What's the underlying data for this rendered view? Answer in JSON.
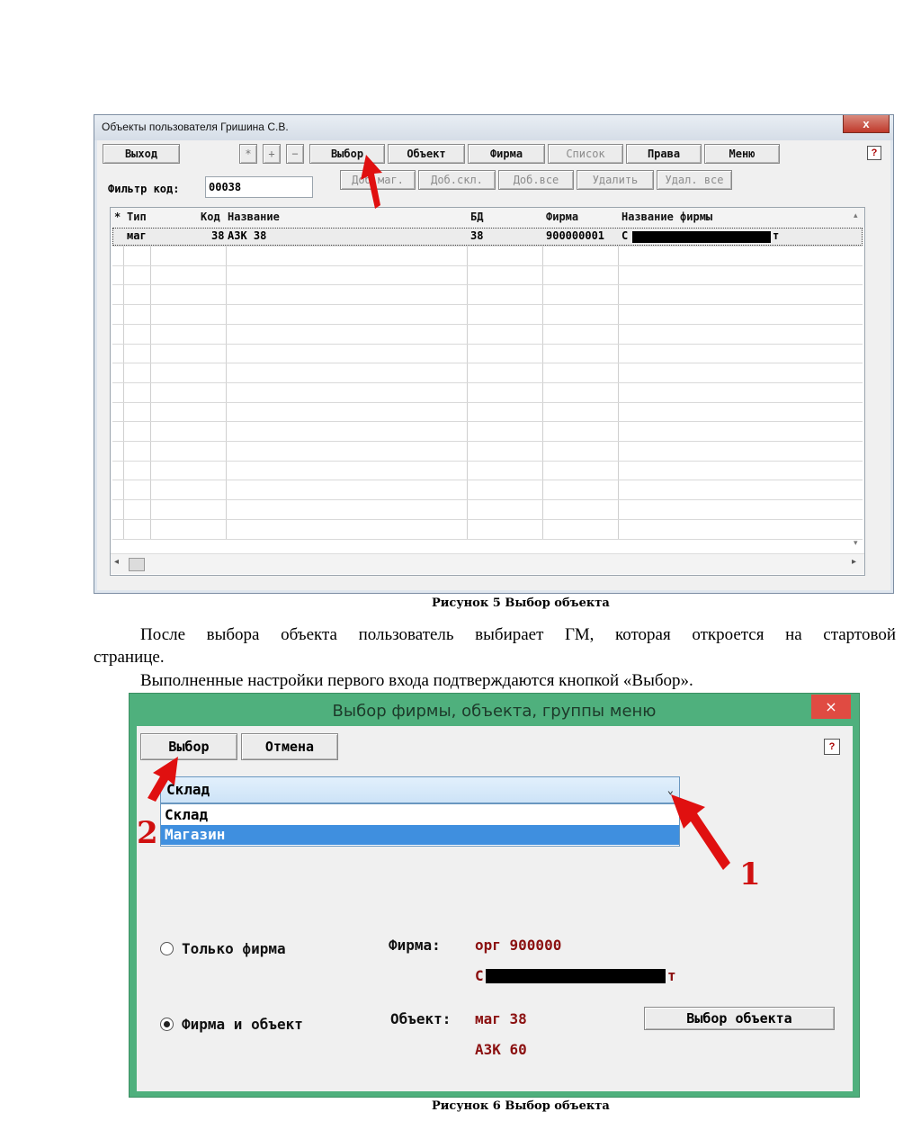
{
  "window1": {
    "title": "Объекты пользователя Гришина С.В.",
    "close_glyph": "x",
    "help_glyph": "?",
    "buttons_row1": {
      "exit": "Выход",
      "star": "*",
      "plus": "+",
      "minus": "−",
      "select": "Выбор",
      "object": "Объект",
      "firm": "Фирма",
      "list": "Список",
      "rights": "Права",
      "menu": "Меню"
    },
    "buttons_row2": {
      "add_shop": "Доб.маг.",
      "add_warehouse": "Доб.скл.",
      "add_all": "Доб.все",
      "delete": "Удалить",
      "delete_all": "Удал. все"
    },
    "filter": {
      "label": "Фильтр код:",
      "value": "00038"
    },
    "grid": {
      "columns": [
        "*",
        "Тип",
        "Код",
        "Название",
        "БД",
        "Фирма",
        "Название фирмы"
      ],
      "rows": [
        {
          "type": "маг",
          "code": "38",
          "name": "АЗК 38",
          "db": "38",
          "firm": "900000001",
          "firm_name_start": "С",
          "firm_name_end": "т"
        }
      ]
    }
  },
  "caption1": "Рисунок 5 Выбор объекта",
  "paragraph": {
    "line1": "После выбора объекта пользователь выбирает ГМ, которая откроется на стартовой",
    "line2": "странице.",
    "line3": "Выполненные настройки первого входа подтверждаются кнопкой «Выбор»."
  },
  "window2": {
    "title": "Выбор фирмы, объекта, группы меню",
    "close_glyph": "×",
    "help_glyph": "?",
    "select_button": "Выбор",
    "cancel_button": "Отмена",
    "combo_value": "Склад",
    "combo_chevron": "⌄",
    "options": [
      "Склад",
      "Магазин"
    ],
    "radio_firm_only": "Только фирма",
    "radio_firm_object": "Фирма и объект",
    "firm_label": "Фирма:",
    "firm_value": "орг 900000",
    "firm_name_start": "С",
    "firm_name_end": "т",
    "object_label": "Объект:",
    "object_value": "маг 38",
    "object_name": "АЗК 60",
    "choose_object_button": "Выбор объекта"
  },
  "annotations": {
    "num1": "1",
    "num2": "2"
  },
  "caption2": "Рисунок 6 Выбор объекта",
  "colors": {
    "accent_green": "#4fb07d",
    "arrow_red": "#e01010",
    "value_red": "#8b1010",
    "selected_blue": "#3f8fdf"
  }
}
